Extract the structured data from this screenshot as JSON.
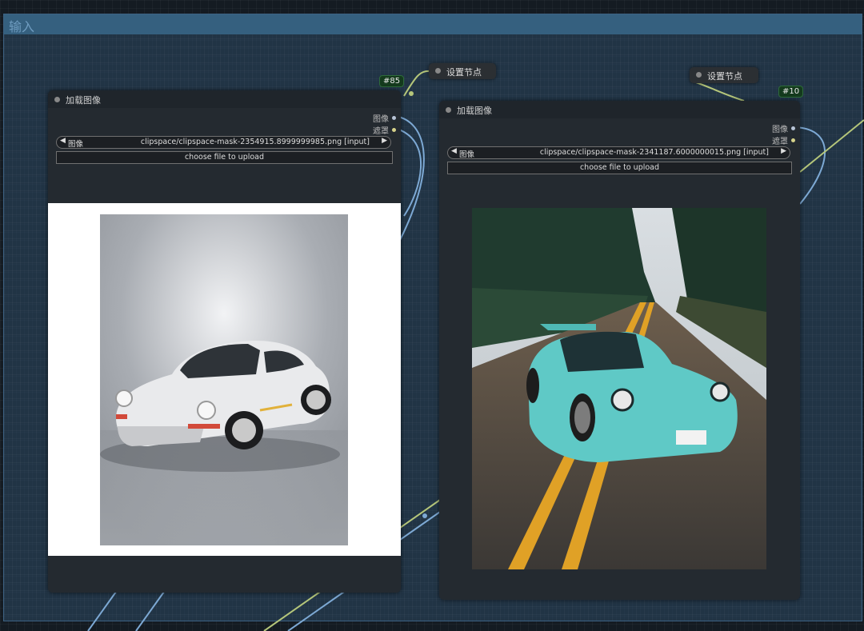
{
  "group": {
    "title": "输入"
  },
  "node_left": {
    "title": "加载图像",
    "badge": "#85",
    "outputs": [
      "图像",
      "遮罩"
    ],
    "combo_label": "图像",
    "combo_value": "clipspace/clipspace-mask-2354915.8999999985.png [input]",
    "upload_label": "choose file to upload",
    "preview_image": "white Porsche 911 studio photo"
  },
  "node_right": {
    "title": "加载图像",
    "badge": "#10",
    "outputs": [
      "图像",
      "遮罩"
    ],
    "combo_label": "图像",
    "combo_value": "clipspace/clipspace-mask-2341187.6000000015.png [input]",
    "upload_label": "choose file to upload",
    "preview_image": "teal widebody Porsche on forest road"
  },
  "set_nodes": [
    {
      "label": "设置节点"
    },
    {
      "label": "设置节点"
    }
  ],
  "colors": {
    "image_output": "#6aa0d8",
    "mask_output": "#b5c67a",
    "badge_bg": "#143a1d",
    "group_header": "#35607f"
  },
  "icons": {
    "combo_left": "◀",
    "combo_right": "▶"
  }
}
